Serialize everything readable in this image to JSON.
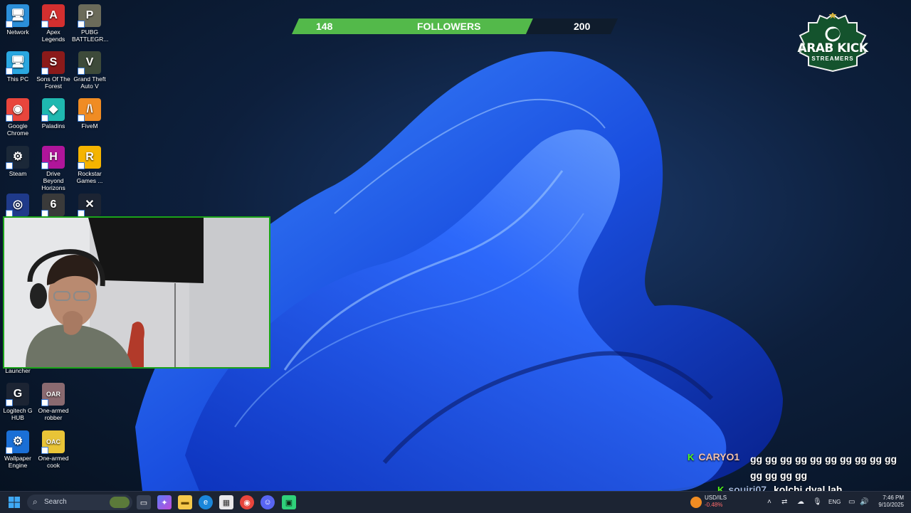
{
  "desktop_icons": [
    {
      "label": "Network",
      "icon": "network-icon",
      "color": "#2b8fd9",
      "glyph": "🖥"
    },
    {
      "label": "Apex Legends",
      "icon": "apex-legends-icon",
      "color": "#d32f2f",
      "glyph": "A"
    },
    {
      "label": "PUBG BATTLEGR...",
      "icon": "pubg-icon",
      "color": "#6b6b5a",
      "glyph": "P"
    },
    {
      "label": "This PC",
      "icon": "this-pc-icon",
      "color": "#2aa7e0",
      "glyph": "🖥"
    },
    {
      "label": "Sons Of The Forest",
      "icon": "sons-of-the-forest-icon",
      "color": "#8b1a1a",
      "glyph": "S"
    },
    {
      "label": "Grand Theft Auto V",
      "icon": "gta-v-icon",
      "color": "#3d4a3a",
      "glyph": "V"
    },
    {
      "label": "Google Chrome",
      "icon": "chrome-icon",
      "color": "#e8453c",
      "glyph": "◉"
    },
    {
      "label": "Paladins",
      "icon": "paladins-icon",
      "color": "#1fb8b0",
      "glyph": "◆"
    },
    {
      "label": "FiveM",
      "icon": "fivem-icon",
      "color": "#f08c23",
      "glyph": "/\\"
    },
    {
      "label": "Steam",
      "icon": "steam-icon",
      "color": "#1b2838",
      "glyph": "⚙"
    },
    {
      "label": "Drive Beyond Horizons",
      "icon": "drive-beyond-horizons-icon",
      "color": "#b0159a",
      "glyph": "H"
    },
    {
      "label": "Rockstar Games ...",
      "icon": "rockstar-icon",
      "color": "#f5b400",
      "glyph": "R"
    },
    {
      "label": "",
      "icon": "ubisoft-icon",
      "color": "#1f3a8a",
      "glyph": "◎"
    },
    {
      "label": "",
      "icon": "rainbow-six-icon",
      "color": "#3a3a3a",
      "glyph": "6"
    },
    {
      "label": "",
      "icon": "anvil-icon",
      "color": "#1c2433",
      "glyph": "✕"
    },
    {
      "label": "Logitech G HUB",
      "icon": "logitech-icon",
      "color": "#1c2433",
      "glyph": "G"
    },
    {
      "label": "One-armed robber",
      "icon": "one-armed-robber-icon",
      "color": "#8a6a70",
      "glyph": "OAR"
    },
    {
      "label": "Wallpaper Engine",
      "icon": "wallpaper-engine-icon",
      "color": "#1a6fd6",
      "glyph": "⚙"
    },
    {
      "label": "One-armed cook",
      "icon": "one-armed-cook-icon",
      "color": "#e9c437",
      "glyph": "OAC"
    }
  ],
  "hidden_label": "Launcher",
  "followers": {
    "current": "148",
    "label": "FOLLOWERS",
    "goal": "200",
    "progress": 0.74,
    "fill_color": "#53b94a"
  },
  "logo": {
    "line1": "ARAB KICK",
    "line2": "STREAMERS",
    "color": "#14532d"
  },
  "chat": [
    {
      "user": "CARYO1",
      "message": "gg gg gg gg gg gg gg gg gg gg",
      "message2": "gg gg gg gg",
      "user_color": "#f3c3b0"
    },
    {
      "user": "souiri07",
      "message": "kolchi dyal lah",
      "user_color": "#9fb4d9"
    }
  ],
  "taskbar": {
    "search_placeholder": "Search",
    "stock_name": "USD/ILS",
    "stock_change": "-0.48%",
    "language": "ENG",
    "time": "7:46 PM",
    "date": "9/10/2025"
  }
}
